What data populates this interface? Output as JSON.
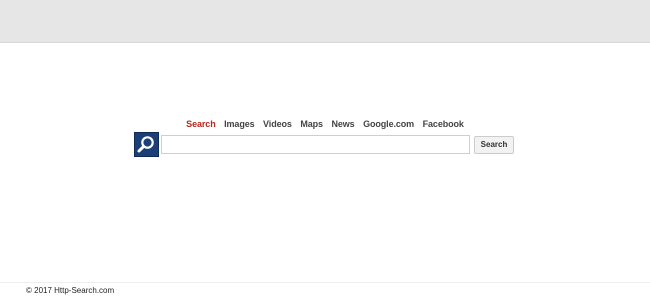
{
  "nav": {
    "items": [
      {
        "label": "Search",
        "active": true
      },
      {
        "label": "Images",
        "active": false
      },
      {
        "label": "Videos",
        "active": false
      },
      {
        "label": "Maps",
        "active": false
      },
      {
        "label": "News",
        "active": false
      },
      {
        "label": "Google.com",
        "active": false
      },
      {
        "label": "Facebook",
        "active": false
      }
    ]
  },
  "logo": {
    "icon": "magnifier-icon",
    "color": "#1d3f77"
  },
  "search": {
    "value": "",
    "placeholder": "",
    "button_label": "Search"
  },
  "footer": {
    "text": "© 2017 Http-Search.com"
  },
  "colors": {
    "active_nav": "#b8281e",
    "nav_text": "#444444",
    "top_bar": "#e6e6e6"
  }
}
